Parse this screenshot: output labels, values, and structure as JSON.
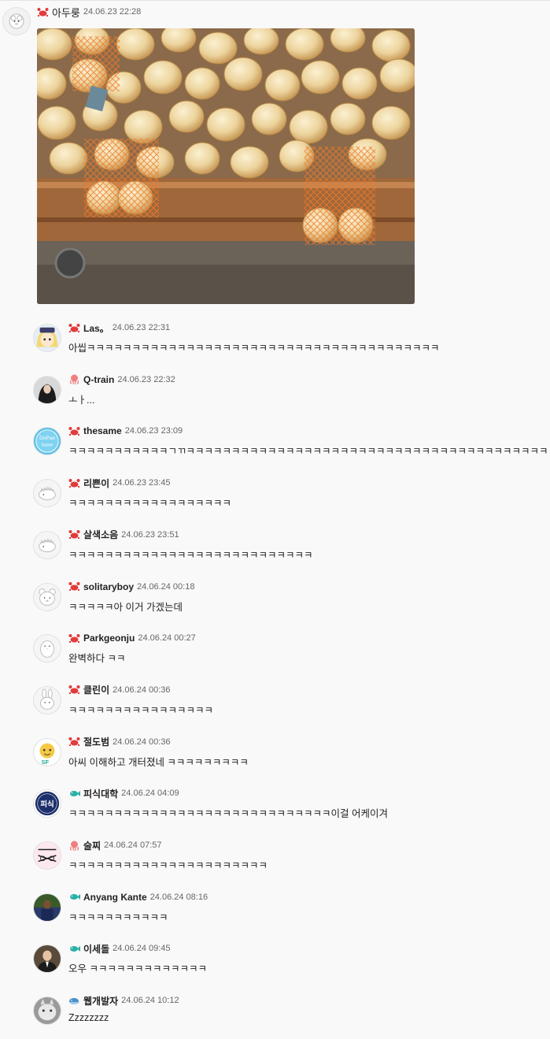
{
  "post": {
    "nickname": "아두룽",
    "date": "24.06.23 22:28",
    "badge": "crab",
    "avatar_icon": "sheep-icon",
    "image_alt": "onions in mesh bags at grocery"
  },
  "colors": {
    "crab": "#e23b3b",
    "octopus": "#f08080",
    "fish": "#2ab0a8",
    "whale": "#4a90c8"
  },
  "comments": [
    {
      "nickname": "Las。",
      "date": "24.06.23 22:31",
      "badge": "crab",
      "avatar": "cartoon-avatar-blonde",
      "text": "아씹ㅋㅋㅋㅋㅋㅋㅋㅋㅋㅋㅋㅋㅋㅋㅋㅋㅋㅋㅋㅋㅋㅋㅋㅋㅋㅋㅋㅋㅋㅋㅋㅋㅋㅋㅋㅋㅋㅋㅋ"
    },
    {
      "nickname": "Q-train",
      "date": "24.06.23 22:32",
      "badge": "octopus",
      "avatar": "photo-avatar-dark",
      "text": "ㅗㅏ..."
    },
    {
      "nickname": "thesame",
      "date": "24.06.23 23:09",
      "badge": "crab",
      "avatar": "logo-avatar-blue",
      "text": "ㅋㅋㅋㅋㅋㅋㅋㅋㅋㅋㅋㄱㄲㅋㅋㅋㅋㅋㅋㅋㅋㅋㅋㅋㅋㅋㅋㅋㅋㅋㅋㅋㅋㅋㅋㅋㅋㅋㅋㅋㅋㅋㅋㅋㅋㅋㅋㅋㅋㅋㅋㅋㅋ"
    },
    {
      "nickname": "리쁜이",
      "date": "24.06.23 23:45",
      "badge": "crab",
      "avatar": "default-avatar-hedgehog",
      "text": "ㅋㅋㅋㅋㅋㅋㅋㅋㅋㅋㅋㅋㅋㅋㅋㅋㅋㅋ"
    },
    {
      "nickname": "살색소음",
      "date": "24.06.23 23:51",
      "badge": "crab",
      "avatar": "default-avatar-hedgehog",
      "text": "ㅋㅋㅋㅋㅋㅋㅋㅋㅋㅋㅋㅋㅋㅋㅋㅋㅋㅋㅋㅋㅋㅋㅋㅋㅋㅋㅋ"
    },
    {
      "nickname": "solitaryboy",
      "date": "24.06.24 00:18",
      "badge": "crab",
      "avatar": "default-avatar-bear",
      "text": "ㅋㅋㅋㅋㅋ아 이거 가겠는데"
    },
    {
      "nickname": "Parkgeonju",
      "date": "24.06.24 00:27",
      "badge": "crab",
      "avatar": "default-avatar-penguin",
      "text": "완벽하다 ㅋㅋ"
    },
    {
      "nickname": "클린이",
      "date": "24.06.24 00:36",
      "badge": "crab",
      "avatar": "default-avatar-rabbit",
      "text": "ㅋㅋㅋㅋㅋㅋㅋㅋㅋㅋㅋㅋㅋㅋㅋㅋ"
    },
    {
      "nickname": "절도범",
      "date": "24.06.24 00:36",
      "badge": "crab",
      "avatar": "cartoon-avatar-yellow",
      "text": "아씨 이해하고 개터졌네 ㅋㅋㅋㅋㅋㅋㅋㅋㅋ"
    },
    {
      "nickname": "피식대학",
      "date": "24.06.24 04:09",
      "badge": "fish",
      "avatar": "logo-avatar-navy",
      "text": "ㅋㅋㅋㅋㅋㅋㅋㅋㅋㅋㅋㅋㅋㅋㅋㅋㅋㅋㅋㅋㅋㅋㅋㅋㅋㅋㅋㅋㅋ이걸 어케이겨"
    },
    {
      "nickname": "술찌",
      "date": "24.06.24 07:57",
      "badge": "octopus",
      "avatar": "sketch-avatar",
      "text": "ㅋㅋㅋㅋㅋㅋㅋㅋㅋㅋㅋㅋㅋㅋㅋㅋㅋㅋㅋㅋㅋㅋ"
    },
    {
      "nickname": "Anyang Kante",
      "date": "24.06.24 08:16",
      "badge": "fish",
      "avatar": "photo-avatar-soccer",
      "text": "ㅋㅋㅋㅋㅋㅋㅋㅋㅋㅋㅋ"
    },
    {
      "nickname": "이세돌",
      "date": "24.06.24 09:45",
      "badge": "fish",
      "avatar": "photo-avatar-suit",
      "text": "오우 ㅋㅋㅋㅋㅋㅋㅋㅋㅋㅋㅋㅋㅋ"
    },
    {
      "nickname": "웹개발자",
      "date": "24.06.24 10:12",
      "badge": "whale",
      "avatar": "photo-avatar-cat",
      "text": "Zzzzzzzz"
    }
  ]
}
